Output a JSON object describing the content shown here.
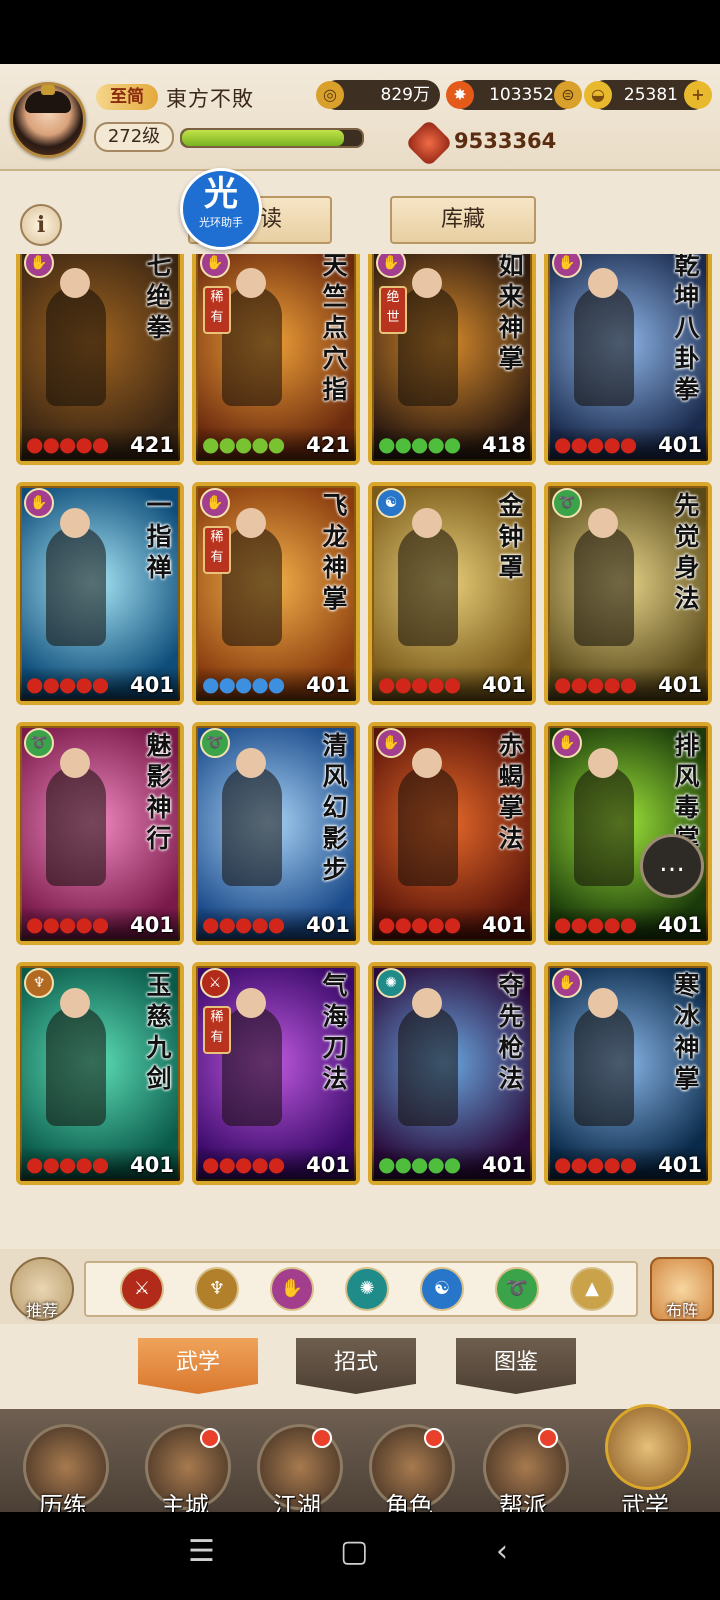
{
  "header": {
    "vip_label": "至简",
    "player_name": "東方不敗",
    "level": "272级",
    "exp_fraction": 0.9,
    "copper": "829万",
    "yuanbao_silver": "103352",
    "gold": "25381",
    "power": "9533364"
  },
  "top_tabs": {
    "read_label": "读",
    "storage_label": "库藏",
    "assistant_big": "光",
    "assistant_small": "光环助手"
  },
  "cards": [
    {
      "title": "七绝拳",
      "level": "421",
      "drops": "●●●●●",
      "drop_color": "#d2261a",
      "rarity": "",
      "bg": "#3b2613",
      "bg2": "#a06420",
      "type_color": "#a33d8e"
    },
    {
      "title": "天竺点穴指",
      "level": "421",
      "drops": "●●●●●",
      "drop_color": "#79c232",
      "rarity": "稀有",
      "bg": "#6b2a0e",
      "bg2": "#f0a138",
      "type_color": "#a33d8e"
    },
    {
      "title": "如来神掌",
      "level": "418",
      "drops": "●●●●●",
      "drop_color": "#4fbe3c",
      "rarity": "绝世",
      "bg": "#2c1a10",
      "bg2": "#d68a2c",
      "type_color": "#a33d8e"
    },
    {
      "title": "乾坤八卦拳",
      "level": "401",
      "drops": "●●●●●",
      "drop_color": "#d2261a",
      "rarity": "",
      "bg": "#1a2a4d",
      "bg2": "#8fb6e8",
      "type_color": "#a33d8e"
    },
    {
      "title": "一指禅",
      "level": "401",
      "drops": "●●●●●",
      "drop_color": "#d2261a",
      "rarity": "",
      "bg": "#0e4d7a",
      "bg2": "#a8e6f5",
      "type_color": "#a33d8e"
    },
    {
      "title": "飞龙神掌",
      "level": "401",
      "drops": "●●●●●",
      "drop_color": "#3d8fe0",
      "rarity": "稀有",
      "bg": "#8a3c0e",
      "bg2": "#f4b24b",
      "type_color": "#a33d8e"
    },
    {
      "title": "金钟罩",
      "level": "401",
      "drops": "●●●●●",
      "drop_color": "#d2261a",
      "rarity": "",
      "bg": "#7a5a1a",
      "bg2": "#e8cf7a",
      "type_color": "#2876c9"
    },
    {
      "title": "先觉身法",
      "level": "401",
      "drops": "●●●●●",
      "drop_color": "#d2261a",
      "rarity": "",
      "bg": "#5a4a1a",
      "bg2": "#e6d48a",
      "type_color": "#3ba34a"
    },
    {
      "title": "魅影神行",
      "level": "401",
      "drops": "●●●●●",
      "drop_color": "#d2261a",
      "rarity": "",
      "bg": "#7a1a4a",
      "bg2": "#f08ac0",
      "type_color": "#3ba34a"
    },
    {
      "title": "清风幻影步",
      "level": "401",
      "drops": "●●●●●",
      "drop_color": "#d2261a",
      "rarity": "",
      "bg": "#1a4a8a",
      "bg2": "#a9d3f5",
      "type_color": "#3ba34a"
    },
    {
      "title": "赤蝎掌法",
      "level": "401",
      "drops": "●●●●●",
      "drop_color": "#d2261a",
      "rarity": "",
      "bg": "#5a150a",
      "bg2": "#e86a2a",
      "type_color": "#a33d8e"
    },
    {
      "title": "排风毒掌",
      "level": "401",
      "drops": "●●●●●",
      "drop_color": "#d2261a",
      "rarity": "",
      "bg": "#1a3a0a",
      "bg2": "#9ee43a",
      "type_color": "#a33d8e"
    },
    {
      "title": "玉慈九剑",
      "level": "401",
      "drops": "●●●●●",
      "drop_color": "#d2261a",
      "rarity": "",
      "bg": "#0a5a4a",
      "bg2": "#5ee0b8",
      "type_color": "#b26a22"
    },
    {
      "title": "气海刀法",
      "level": "401",
      "drops": "●●●●●",
      "drop_color": "#d2261a",
      "rarity": "稀有",
      "bg": "#3a0a6a",
      "bg2": "#c05ae0",
      "type_color": "#b22a1a"
    },
    {
      "title": "夺先枪法",
      "level": "401",
      "drops": "●●●●●",
      "drop_color": "#4fbe3c",
      "rarity": "",
      "bg": "#2a0a3a",
      "bg2": "#6aa8e0",
      "type_color": "#1f8c8a"
    },
    {
      "title": "寒冰神掌",
      "level": "401",
      "drops": "●●●●●",
      "drop_color": "#d2261a",
      "rarity": "",
      "bg": "#0a2a4a",
      "bg2": "#8ab6e8",
      "type_color": "#a33d8e"
    }
  ],
  "filter_bar": {
    "recommend_label": "推荐",
    "lineup_label": "布阵",
    "filters": [
      {
        "glyph": "⚔",
        "color": "#b22a1a"
      },
      {
        "glyph": "♆",
        "color": "#b2802a"
      },
      {
        "glyph": "✋",
        "color": "#a33d8e"
      },
      {
        "glyph": "✺",
        "color": "#1f8c8a"
      },
      {
        "glyph": "☯",
        "color": "#2876c9"
      },
      {
        "glyph": "➰",
        "color": "#3ba34a"
      },
      {
        "glyph": "▲",
        "color": "#c9a24a"
      }
    ]
  },
  "sub_tabs": [
    "武学",
    "招式",
    "图鉴"
  ],
  "bottom_nav": [
    {
      "label": "历练",
      "badge": false,
      "icon": "scroll-sword-icon"
    },
    {
      "label": "主城",
      "badge": true,
      "icon": "palace-gate-icon"
    },
    {
      "label": "江湖",
      "badge": true,
      "icon": "sword-coin-icon"
    },
    {
      "label": "角色",
      "badge": true,
      "icon": "straw-hat-hero-icon"
    },
    {
      "label": "帮派",
      "badge": true,
      "icon": "gang-emblem-icon"
    },
    {
      "label": "武学",
      "badge": false,
      "icon": "scroll-pile-icon"
    }
  ],
  "system_nav": {
    "menu": "☰",
    "home": "▢",
    "back": "‹"
  }
}
